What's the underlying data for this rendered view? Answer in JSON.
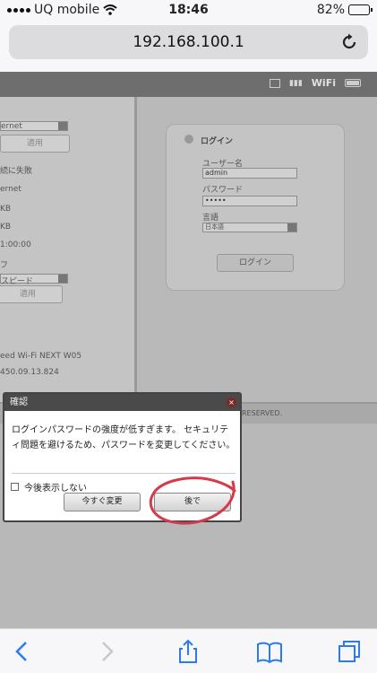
{
  "status_bar": {
    "carrier": "UQ mobile",
    "time": "18:46",
    "battery": "82%",
    "battery_level": 0.82
  },
  "browser": {
    "url": "192.168.100.1"
  },
  "nav_bar": {
    "wifi_label": "WiFi"
  },
  "left_panel": {
    "select1": "ernet",
    "apply1": "適用",
    "line1": "続に失敗",
    "line2": "ernet",
    "line3": "KB",
    "line4": "KB",
    "line5": "1:00:00",
    "line6": "フ",
    "select2": "スピード",
    "apply2": "適用",
    "device": "eed Wi-Fi NEXT W05",
    "version": "450.09.13.824"
  },
  "login_box": {
    "title": "ログイン",
    "username_label": "ユーザー名",
    "username_value": "admin",
    "password_label": "パスワード",
    "password_value": "•••••",
    "language_label": "言語",
    "language_value": "日本語",
    "login_button": "ログイン"
  },
  "footer": {
    "rights": "RESERVED."
  },
  "dialog": {
    "title": "確認",
    "message": "ログインパスワードの強度が低すぎます。 セキュリティ問題を避けるため、パスワードを変更してください。",
    "checkbox_label": "今後表示しない",
    "change_now_button": "今すぐ変更",
    "later_button": "後で"
  }
}
